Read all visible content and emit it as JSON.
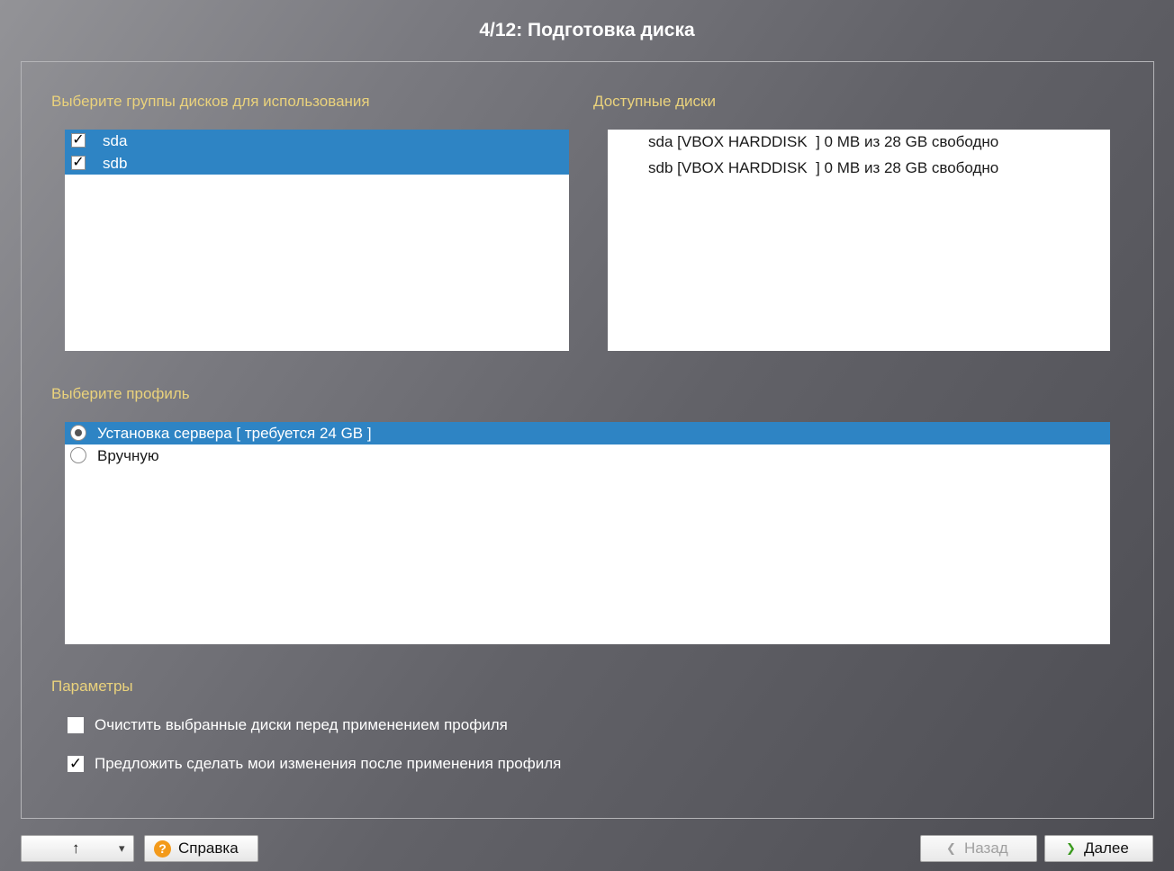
{
  "window": {
    "title": "4/12: Подготовка диска"
  },
  "disk_groups": {
    "label": "Выберите группы дисков для использования",
    "items": [
      {
        "name": "sda",
        "checked": true
      },
      {
        "name": "sdb",
        "checked": true
      }
    ]
  },
  "available_disks": {
    "label": "Доступные диски",
    "items": [
      "sda [VBOX HARDDISK  ] 0 MB из 28 GB свободно",
      "sdb [VBOX HARDDISK  ] 0 MB из 28 GB свободно"
    ]
  },
  "profile": {
    "label": "Выберите профиль",
    "items": [
      {
        "label": "Установка сервера [ требуется 24 GB ]",
        "selected": true
      },
      {
        "label": "Вручную",
        "selected": false
      }
    ]
  },
  "parameters": {
    "label": "Параметры",
    "options": [
      {
        "label": "Очистить выбранные диски перед применением профиля",
        "checked": false
      },
      {
        "label": "Предложить сделать мои изменения после применения профиля",
        "checked": true
      }
    ]
  },
  "footer": {
    "up_glyph": "↑",
    "dropdown_glyph": "▾",
    "help_label": "Справка",
    "help_glyph": "?",
    "back_label": "Назад",
    "back_glyph": "❮",
    "next_label": "Далее",
    "next_glyph": "❯"
  },
  "colors": {
    "section_label": "#ead27c",
    "selection": "#2e84c4",
    "next_arrow": "#3a9a1e",
    "help_icon": "#f39a1b"
  }
}
